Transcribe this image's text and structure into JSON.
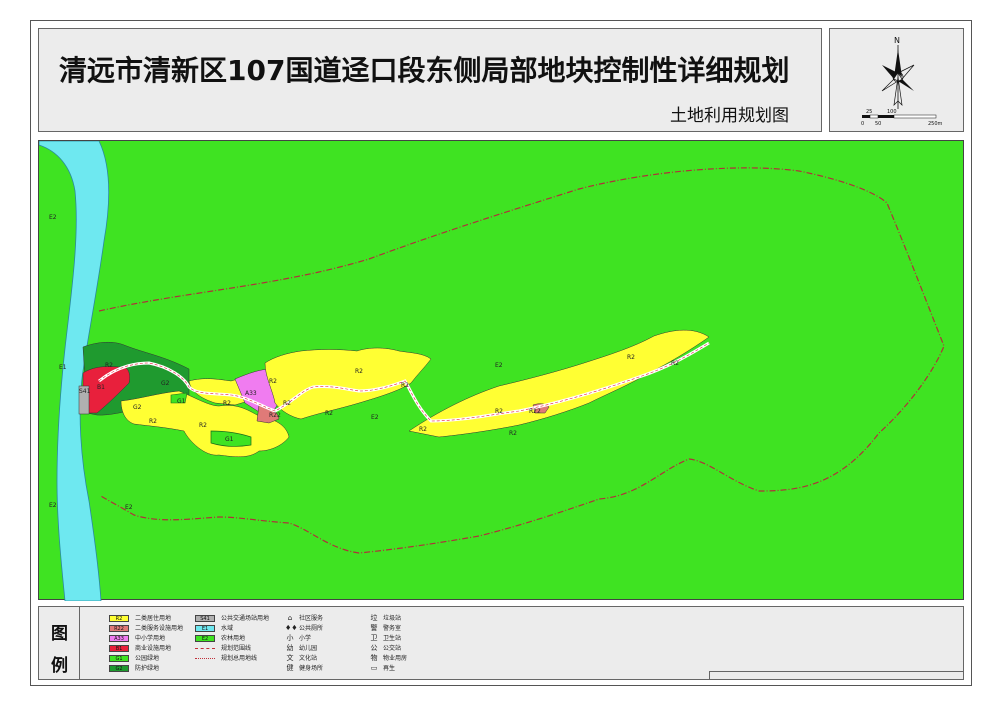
{
  "header": {
    "title": "清远市清新区107国道迳口段东侧局部地块控制性详细规划",
    "subtitle": "土地利用规划图"
  },
  "compass": {
    "north_label": "N",
    "scale_labels": [
      "25",
      "100",
      "0",
      "50",
      "250m"
    ]
  },
  "map": {
    "zone_labels": {
      "e2_left_1": "E2",
      "e2_left_2": "E2",
      "e2_center": "E2",
      "e2_lower": "E2",
      "e2_mid": "E2",
      "e1": "E1",
      "s41": "S41",
      "b1": "B1",
      "r2a": "R2",
      "g2a": "G2",
      "g2b": "G2",
      "g1a": "G1",
      "g1b": "G1",
      "r2b": "R2",
      "r2c": "R2",
      "r2d": "R2",
      "a33": "A33",
      "r22a": "R22",
      "r2e": "R2",
      "r2f": "R2",
      "r2g": "R2",
      "r2h": "R2",
      "r2i": "R2",
      "r2j": "R2",
      "r22b": "R22",
      "r2k": "R2",
      "r2l": "R2",
      "r2m": "R2",
      "r2n": "R2"
    },
    "colors": {
      "background": "#3fe322",
      "river": "#6ee8f0",
      "residential": "#ffff33",
      "commercial": "#e8203c",
      "education": "#f07cf0",
      "service": "#e07a78",
      "park": "#1fb83a",
      "protection": "#1f9a2f",
      "transit": "#b0b0b0"
    }
  },
  "legend": {
    "heading_1": "图",
    "heading_2": "例",
    "col1": [
      {
        "code": "R2",
        "label": "二类居住用地",
        "color": "#ffff33"
      },
      {
        "code": "R22",
        "label": "二类服务设施用地",
        "color": "#e07a78"
      },
      {
        "code": "A33",
        "label": "中小学用地",
        "color": "#f07cf0"
      },
      {
        "code": "B1",
        "label": "商业设施用地",
        "color": "#e8203c"
      },
      {
        "code": "G1",
        "label": "公园绿地",
        "color": "#3fe322"
      },
      {
        "code": "G2",
        "label": "防护绿地",
        "color": "#1f9a2f"
      }
    ],
    "col2": [
      {
        "code": "S41",
        "label": "公共交通场站用地",
        "color": "#b0b0b0"
      },
      {
        "code": "E1",
        "label": "水域",
        "color": "#6ee8f0"
      },
      {
        "code": "E2",
        "label": "农林用地",
        "color": "#3fe322"
      },
      {
        "code": "",
        "label": "规划范围线"
      },
      {
        "code": "",
        "label": "规划总用地线"
      }
    ],
    "col3": [
      {
        "icon": "⌂",
        "label": "社区服务"
      },
      {
        "icon": "♦♦",
        "label": "公共厕所"
      },
      {
        "icon": "小",
        "label": "小学"
      },
      {
        "icon": "幼",
        "label": "幼儿园"
      },
      {
        "icon": "文",
        "label": "文化站"
      },
      {
        "icon": "健",
        "label": "健身场所"
      }
    ],
    "col4": [
      {
        "icon": "垃",
        "label": "垃圾站"
      },
      {
        "icon": "警",
        "label": "警务室"
      },
      {
        "icon": "卫",
        "label": "卫生站"
      },
      {
        "icon": "公",
        "label": "公交站"
      },
      {
        "icon": "物",
        "label": "物业用房"
      },
      {
        "icon": "▭",
        "label": "再生"
      }
    ]
  }
}
